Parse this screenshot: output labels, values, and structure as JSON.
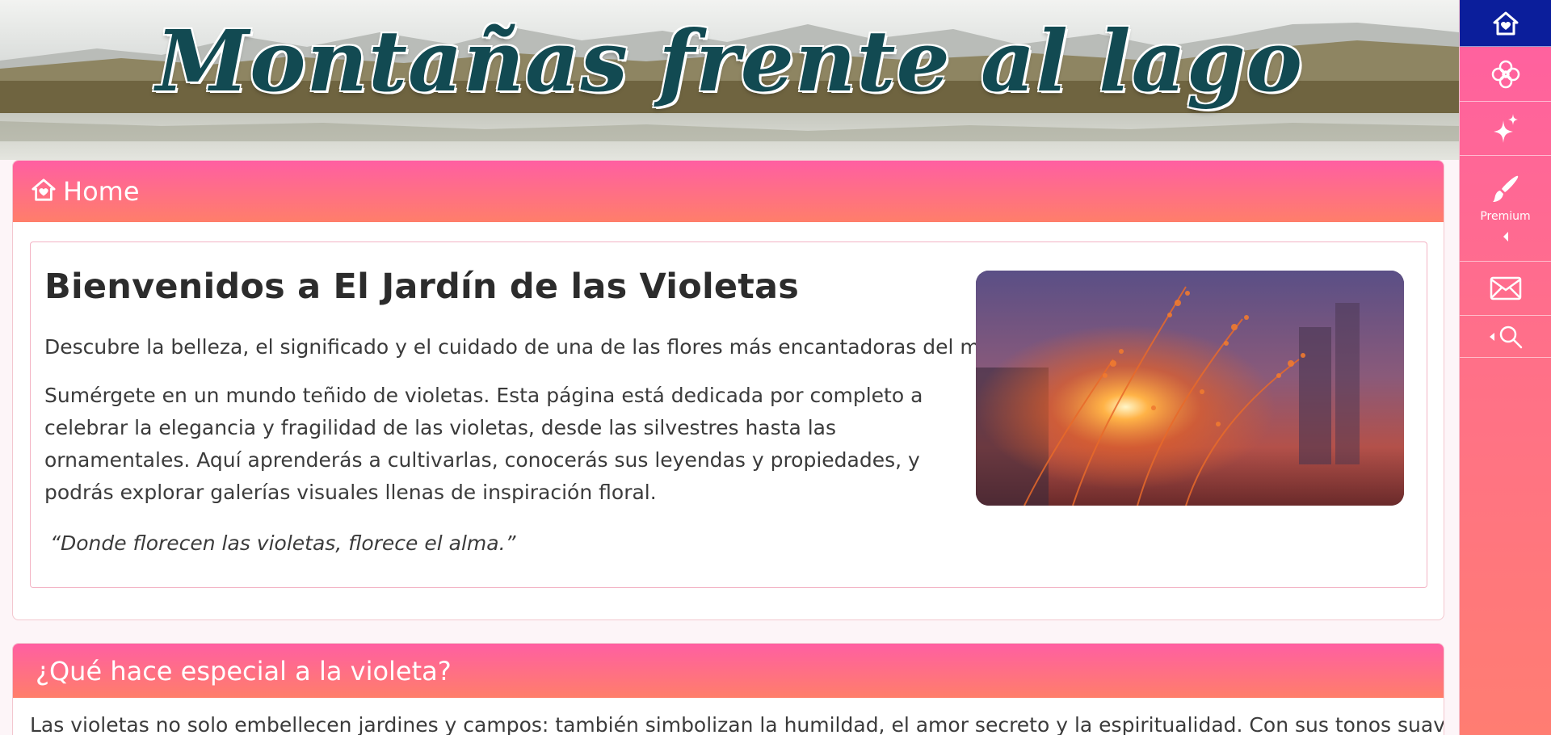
{
  "banner": {
    "title": "Montañas frente al lago"
  },
  "sidebar": {
    "items": [
      {
        "icon": "home-heart-icon",
        "active": true
      },
      {
        "icon": "flower-icon"
      },
      {
        "icon": "sparkles-icon"
      },
      {
        "icon": "paintbrush-icon",
        "label": "Premium",
        "caret": "caret-left-icon"
      },
      {
        "icon": "envelope-icon"
      },
      {
        "icon": "search-icon",
        "caret": "caret-left-icon"
      }
    ],
    "active_color": "#0b1e9b",
    "gradient": [
      "#ff5fa2",
      "#ff7d72"
    ]
  },
  "home_section": {
    "header_icon": "home-heart-icon",
    "title": "Home",
    "heading": "Bienvenidos a El Jardín de las Violetas",
    "paragraph1": "Descubre la belleza, el significado y el cuidado de una de las flores más encantadoras del mundo.",
    "paragraph2": "Sumérgete en un mundo teñido de violetas. Esta página está dedicada por completo a celebrar la elegancia y fragilidad de las violetas, desde las silvestres hasta las ornamentales. Aquí aprenderás a cultivarlas, conocerás sus leyendas y propiedades, y podrás explorar galerías visuales llenas de inspiración floral.",
    "quote": "“Donde florecen las violetas, florece el alma.”"
  },
  "special_section": {
    "title": "¿Qué hace especial a la violeta?",
    "text": "Las violetas no solo embellecen jardines y campos: también simbolizan la humildad, el amor secreto y la espiritualidad. Con sus tonos suaves y su"
  },
  "colors": {
    "header_gradient_top": "#ff5fa2",
    "header_gradient_bottom": "#ff7e6a",
    "banner_title": "#124a52"
  }
}
